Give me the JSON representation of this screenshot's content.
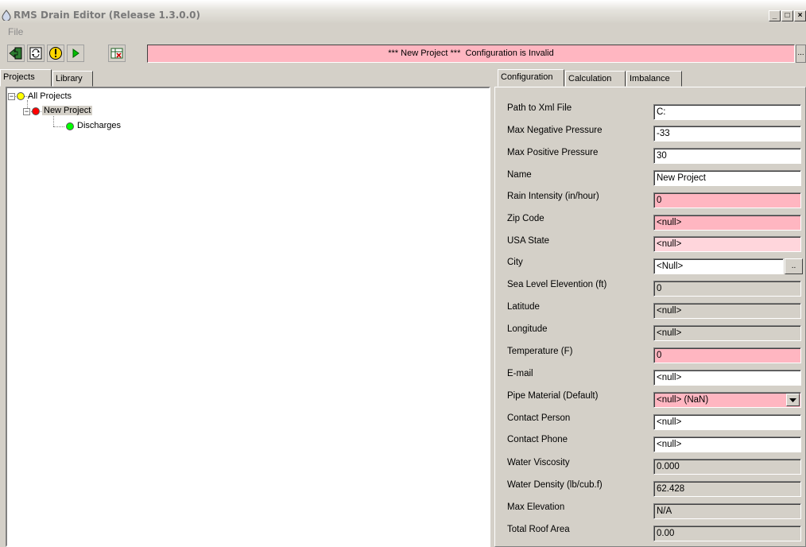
{
  "window": {
    "title": "RMS Drain Editor (Release 1.3.0.0)",
    "min": "_",
    "max": "□",
    "close": "×"
  },
  "menu": {
    "file": "File"
  },
  "toolbar": {
    "status_text": "*** New Project ***  Configuration is Invalid",
    "more": "...",
    "status_color": "#ffb6c1"
  },
  "left_tabs": [
    "Projects",
    "Library"
  ],
  "tree": [
    {
      "label": "All Projects",
      "status": "yellow"
    },
    {
      "label": "New Project",
      "status": "red",
      "selected": true
    },
    {
      "label": "Discharges",
      "status": "green"
    }
  ],
  "right_tabs": [
    "Configuration",
    "Calculation",
    "Imbalance"
  ],
  "config": {
    "fields": [
      {
        "label": "Path to Xml File",
        "value": "C:",
        "style": "white"
      },
      {
        "label": "Max Negative Pressure",
        "value": "-33",
        "style": "white"
      },
      {
        "label": "Max Positive Pressure",
        "value": "30",
        "style": "white"
      },
      {
        "label": "Name",
        "value": "New Project",
        "style": "white"
      },
      {
        "label": "Rain Intensity (in/hour)",
        "value": "0",
        "style": "pink"
      },
      {
        "label": "Zip Code",
        "value": "<null>",
        "style": "pink"
      },
      {
        "label": "USA State",
        "value": "<null>",
        "style": "lightpink"
      },
      {
        "label": "City",
        "value": "<Null>",
        "style": "white",
        "button": ".."
      },
      {
        "label": "Sea Level Elevention (ft)",
        "value": "0",
        "style": "gray"
      },
      {
        "label": "Latitude",
        "value": "<null>",
        "style": "gray"
      },
      {
        "label": "Longitude",
        "value": "<null>",
        "style": "gray"
      },
      {
        "label": "Temperature (F)",
        "value": "0",
        "style": "pink"
      },
      {
        "label": "E-mail",
        "value": "<null>",
        "style": "white"
      },
      {
        "label": "Pipe Material (Default)",
        "value": "<null> (NaN)",
        "style": "pink",
        "dropdown": true
      },
      {
        "label": "Contact Person",
        "value": "<null>",
        "style": "white"
      },
      {
        "label": "Contact Phone",
        "value": "<null>",
        "style": "white"
      },
      {
        "label": "Water Viscosity",
        "value": "0.000",
        "style": "gray"
      },
      {
        "label": "Water Density (lb/cub.f)",
        "value": "62.428",
        "style": "gray"
      },
      {
        "label": "Max Elevation",
        "value": "N/A",
        "style": "gray"
      },
      {
        "label": "Total Roof Area",
        "value": "0.00",
        "style": "gray"
      }
    ]
  },
  "colors": {
    "invalid": "#ffb6c1",
    "invalid_light": "#ffd6dc",
    "readonly": "#d4d0c8",
    "yellow": "#ffff00",
    "red": "#ff0000",
    "green": "#00ff00"
  }
}
